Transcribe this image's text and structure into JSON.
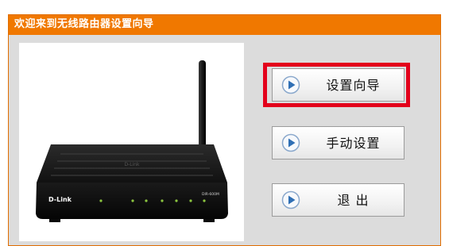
{
  "window": {
    "title": "欢迎来到无线路由器设置向导"
  },
  "router": {
    "brand": "D-Link",
    "model": "DIR-600M"
  },
  "buttons": {
    "wizard_label": "设置向导",
    "manual_label": "手动设置",
    "exit_label": "退 出"
  },
  "colors": {
    "title_bar": "#f07800",
    "panel": "#dcdcdc",
    "highlight": "#e3001b",
    "play_icon": "#2f6fb5"
  }
}
